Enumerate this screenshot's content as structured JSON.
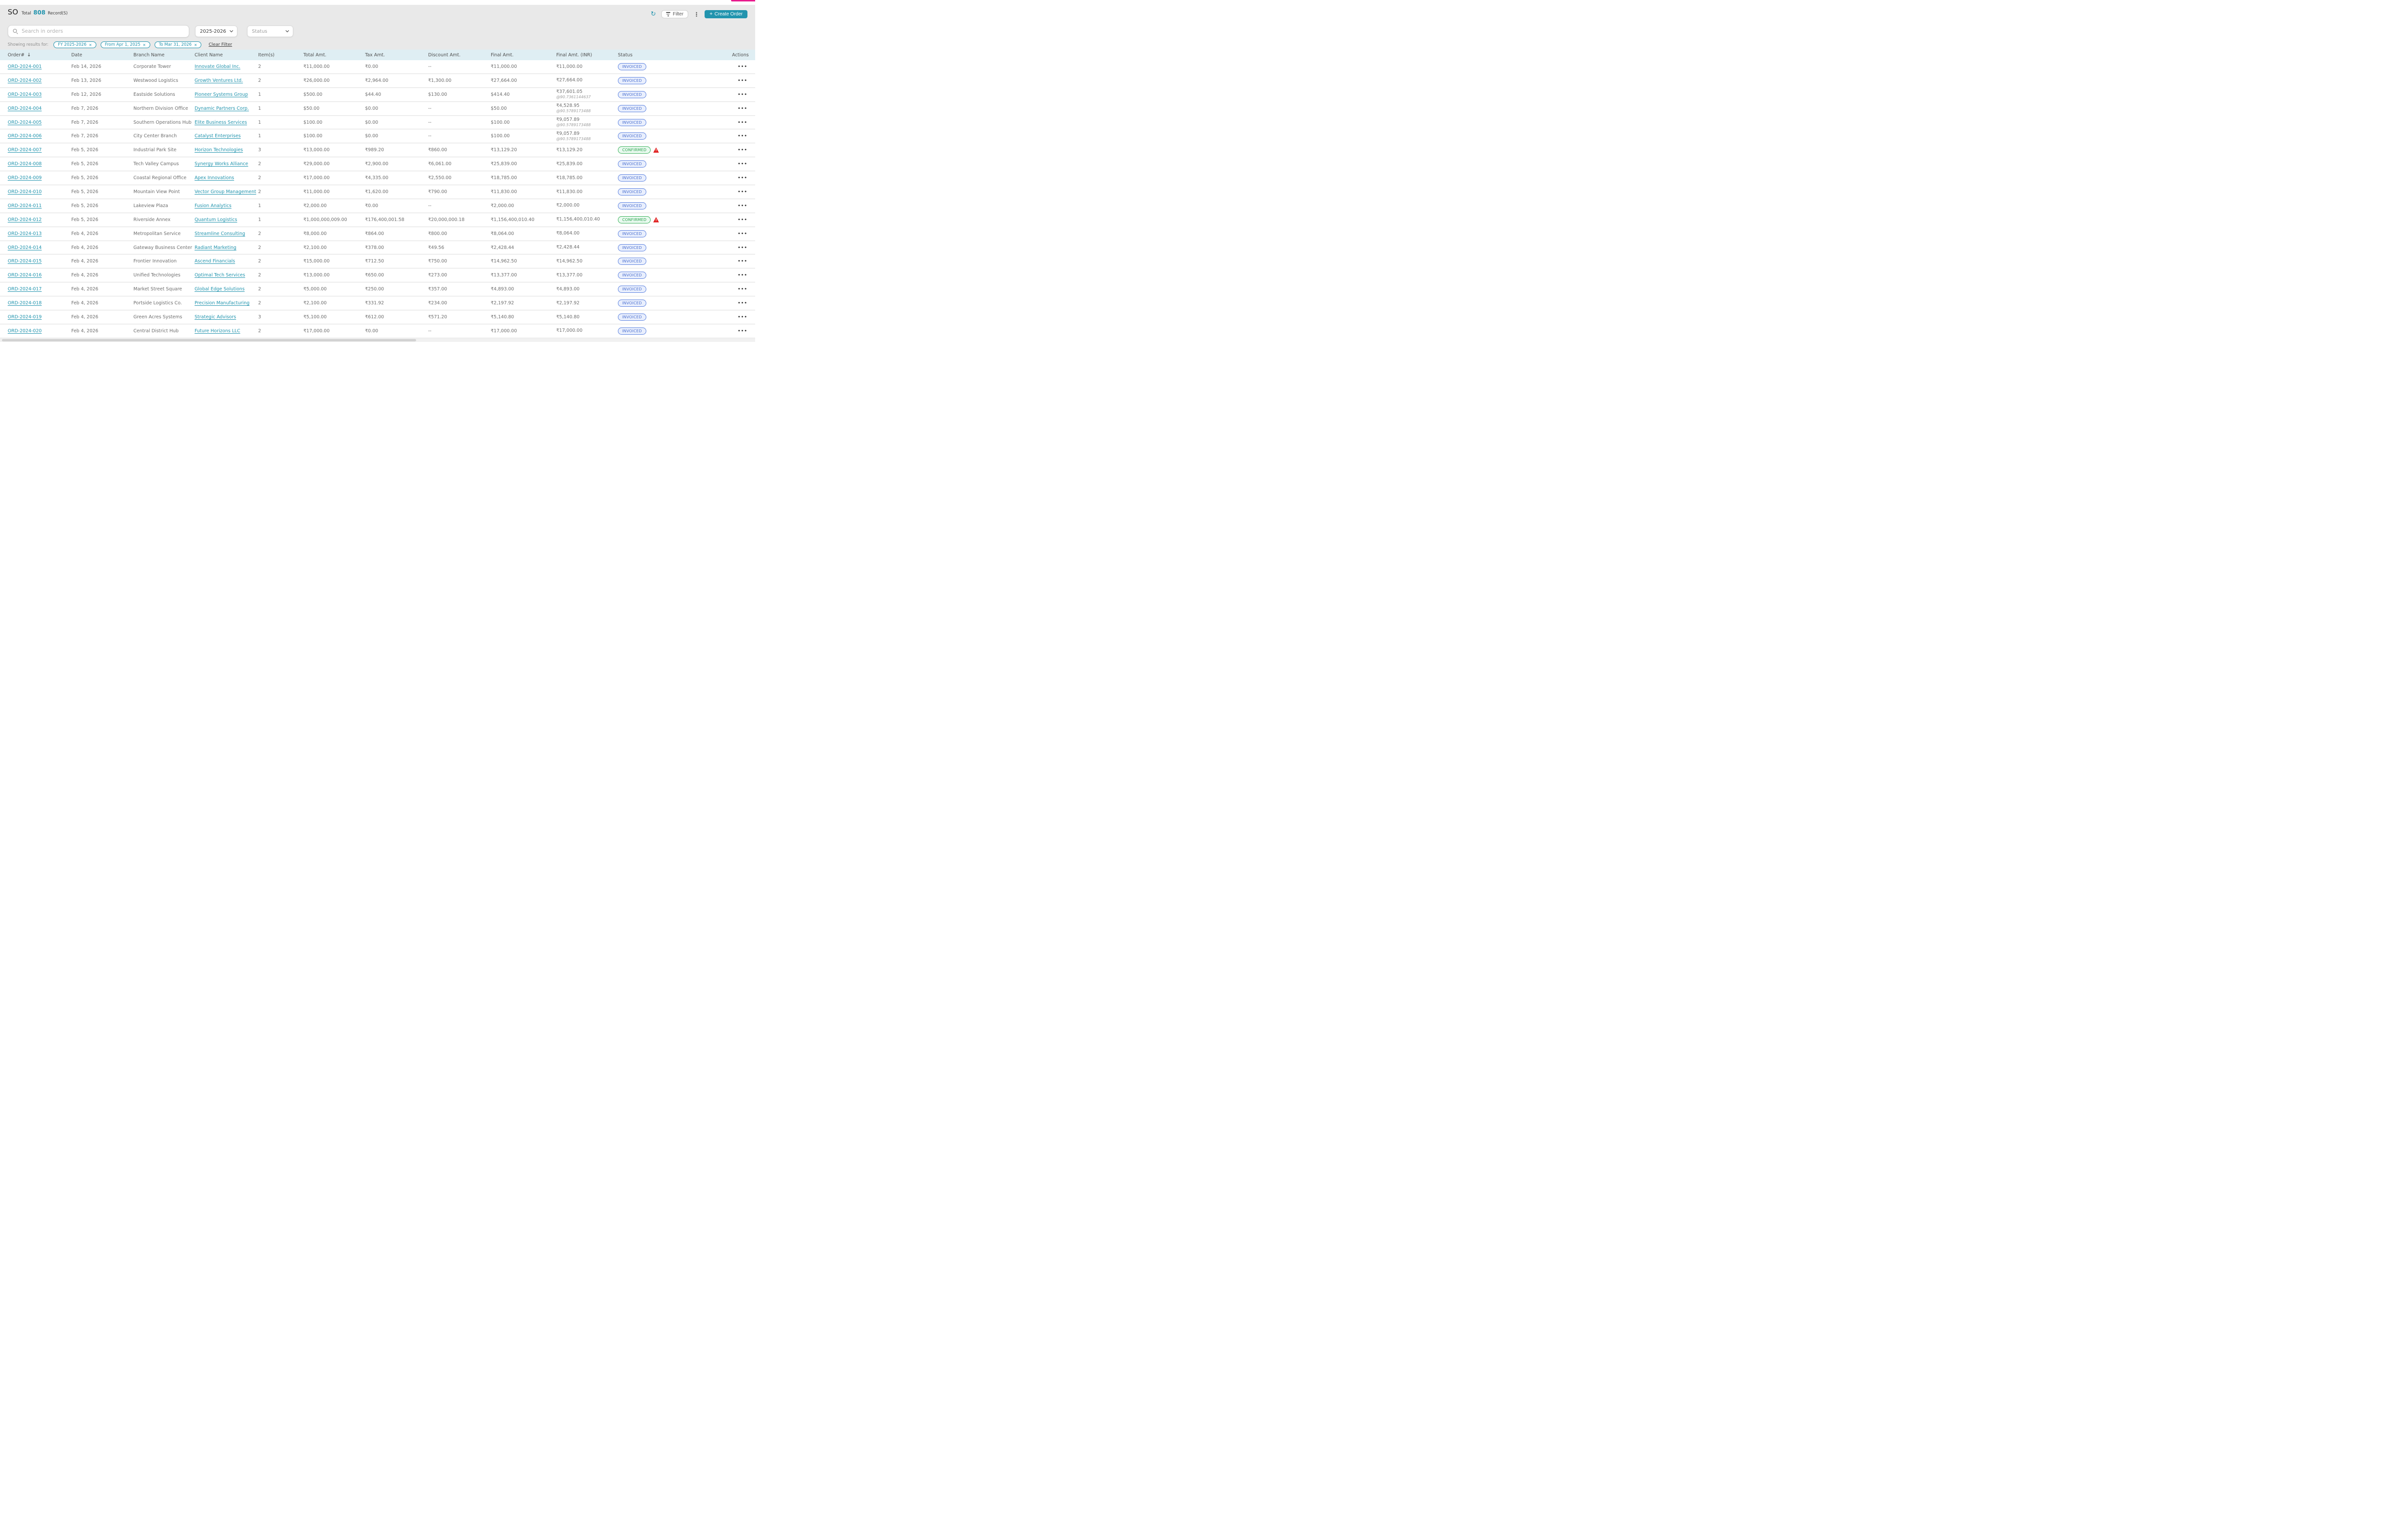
{
  "colors": {
    "accent_teal": "#2294ae",
    "brand_magenta": "#e81c8e",
    "invoiced_blue": "#4a6fd0",
    "confirmed_green": "#2ba24e",
    "warning_red": "#e01e1e",
    "table_header_bg": "#dfeef3",
    "toolbar_bg": "#e9e9e9"
  },
  "header": {
    "title": "SO",
    "total_label": "Total",
    "total_count": "808",
    "records_label": "Record(S)",
    "refresh_icon": "refresh",
    "filter_button_label": "Filter",
    "kebab_icon": "⋮",
    "create_order_plus": "+",
    "create_order_label": "Create Order"
  },
  "controls": {
    "search_placeholder": "Search in orders",
    "fiscal_year_value": "2025-2026",
    "status_placeholder": "Status"
  },
  "filters": {
    "showing_label": "Showing results for:",
    "chips": [
      {
        "label": "FY 2025-2026",
        "close": "✕"
      },
      {
        "label": "From Apr 1, 2025",
        "close": "✕"
      },
      {
        "label": "To Mar 31, 2026",
        "close": "✕"
      }
    ],
    "clear_label": "Clear Filter"
  },
  "table": {
    "columns": [
      "Order#",
      "Date",
      "Branch Name",
      "Client Name",
      "Item(s)",
      "Total Amt.",
      "Tax Amt.",
      "Discount Amt.",
      "Final Amt.",
      "Final Amt. (INR)",
      "Status",
      "Actions"
    ],
    "sort_arrow": "↓",
    "row_actions_icon": "●●●",
    "rows": [
      {
        "order_no": "ORD-2024-001",
        "date": "Feb 14, 2026",
        "branch": "Corporate Tower",
        "client": "Innovate Global Inc.",
        "items": "2",
        "total": "₹11,000.00",
        "tax": "₹0.00",
        "discount": "--",
        "final": "₹11,000.00",
        "inr": "₹11,000.00",
        "inr_rate": "",
        "status": "INVOICED",
        "warning": false
      },
      {
        "order_no": "ORD-2024-002",
        "date": "Feb 13, 2026",
        "branch": "Westwood Logistics",
        "client": "Growth Ventures Ltd.",
        "items": "2",
        "total": "₹26,000.00",
        "tax": "₹2,964.00",
        "discount": "₹1,300.00",
        "final": "₹27,664.00",
        "inr": "₹27,664.00",
        "inr_rate": "",
        "status": "INVOICED",
        "warning": false
      },
      {
        "order_no": "ORD-2024-003",
        "date": "Feb 12, 2026",
        "branch": "Eastside Solutions",
        "client": "Pioneer Systems Group",
        "items": "1",
        "total": "$500.00",
        "tax": "$44.40",
        "discount": "$130.00",
        "final": "$414.40",
        "inr": "₹37,601.05",
        "inr_rate": "@90.7361144637",
        "status": "INVOICED",
        "warning": false
      },
      {
        "order_no": "ORD-2024-004",
        "date": "Feb 7, 2026",
        "branch": "Northern Division Office",
        "client": "Dynamic Partners Corp.",
        "items": "1",
        "total": "$50.00",
        "tax": "$0.00",
        "discount": "--",
        "final": "$50.00",
        "inr": "₹4,528.95",
        "inr_rate": "@90.5789173488",
        "status": "INVOICED",
        "warning": false
      },
      {
        "order_no": "ORD-2024-005",
        "date": "Feb 7, 2026",
        "branch": "Southern Operations Hub",
        "client": "Elite Business Services",
        "items": "1",
        "total": "$100.00",
        "tax": "$0.00",
        "discount": "--",
        "final": "$100.00",
        "inr": "₹9,057.89",
        "inr_rate": "@90.5789173488",
        "status": "INVOICED",
        "warning": false
      },
      {
        "order_no": "ORD-2024-006",
        "date": "Feb 7, 2026",
        "branch": "City Center Branch",
        "client": "Catalyst Enterprises",
        "items": "1",
        "total": "$100.00",
        "tax": "$0.00",
        "discount": "--",
        "final": "$100.00",
        "inr": "₹9,057.89",
        "inr_rate": "@90.5789173488",
        "status": "INVOICED",
        "warning": false
      },
      {
        "order_no": "ORD-2024-007",
        "date": "Feb 5, 2026",
        "branch": "Industrial Park Site",
        "client": "Horizon Technologies",
        "items": "3",
        "total": "₹13,000.00",
        "tax": "₹989.20",
        "discount": "₹860.00",
        "final": "₹13,129.20",
        "inr": "₹13,129.20",
        "inr_rate": "",
        "status": "CONFIRMED",
        "warning": true
      },
      {
        "order_no": "ORD-2024-008",
        "date": "Feb 5, 2026",
        "branch": "Tech Valley Campus",
        "client": "Synergy Works Alliance",
        "items": "2",
        "total": "₹29,000.00",
        "tax": "₹2,900.00",
        "discount": "₹6,061.00",
        "final": "₹25,839.00",
        "inr": "₹25,839.00",
        "inr_rate": "",
        "status": "INVOICED",
        "warning": false
      },
      {
        "order_no": "ORD-2024-009",
        "date": "Feb 5, 2026",
        "branch": "Coastal Regional Office",
        "client": "Apex Innovations",
        "items": "2",
        "total": "₹17,000.00",
        "tax": "₹4,335.00",
        "discount": "₹2,550.00",
        "final": "₹18,785.00",
        "inr": "₹18,785.00",
        "inr_rate": "",
        "status": "INVOICED",
        "warning": false
      },
      {
        "order_no": "ORD-2024-010",
        "date": "Feb 5, 2026",
        "branch": "Mountain View Point",
        "client": "Vector Group Management",
        "items": "2",
        "total": "₹11,000.00",
        "tax": "₹1,620.00",
        "discount": "₹790.00",
        "final": "₹11,830.00",
        "inr": "₹11,830.00",
        "inr_rate": "",
        "status": "INVOICED",
        "warning": false
      },
      {
        "order_no": "ORD-2024-011",
        "date": "Feb 5, 2026",
        "branch": "Lakeview Plaza",
        "client": "Fusion Analytics",
        "items": "1",
        "total": "₹2,000.00",
        "tax": "₹0.00",
        "discount": "--",
        "final": "₹2,000.00",
        "inr": "₹2,000.00",
        "inr_rate": "",
        "status": "INVOICED",
        "warning": false
      },
      {
        "order_no": "ORD-2024-012",
        "date": "Feb 5, 2026",
        "branch": "Riverside Annex",
        "client": "Quantum Logistics",
        "items": "1",
        "total": "₹1,000,000,009.00",
        "tax": "₹176,400,001.58",
        "discount": "₹20,000,000.18",
        "final": "₹1,156,400,010.40",
        "inr": "₹1,156,400,010.40",
        "inr_rate": "",
        "status": "CONFIRMED",
        "warning": true
      },
      {
        "order_no": "ORD-2024-013",
        "date": "Feb 4, 2026",
        "branch": "Metropolitan Service",
        "client": "Streamline Consulting",
        "items": "2",
        "total": "₹8,000.00",
        "tax": "₹864.00",
        "discount": "₹800.00",
        "final": "₹8,064.00",
        "inr": "₹8,064.00",
        "inr_rate": "",
        "status": "INVOICED",
        "warning": false
      },
      {
        "order_no": "ORD-2024-014",
        "date": "Feb 4, 2026",
        "branch": "Gateway Business Center",
        "client": "Radiant Marketing",
        "items": "2",
        "total": "₹2,100.00",
        "tax": "₹378.00",
        "discount": "₹49.56",
        "final": "₹2,428.44",
        "inr": "₹2,428.44",
        "inr_rate": "",
        "status": "INVOICED",
        "warning": false
      },
      {
        "order_no": "ORD-2024-015",
        "date": "Feb 4, 2026",
        "branch": "Frontier Innovation",
        "client": "Ascend Financials",
        "items": "2",
        "total": "₹15,000.00",
        "tax": "₹712.50",
        "discount": "₹750.00",
        "final": "₹14,962.50",
        "inr": "₹14,962.50",
        "inr_rate": "",
        "status": "INVOICED",
        "warning": false
      },
      {
        "order_no": "ORD-2024-016",
        "date": "Feb 4, 2026",
        "branch": "Unified Technologies",
        "client": "Optimal Tech Services",
        "items": "2",
        "total": "₹13,000.00",
        "tax": "₹650.00",
        "discount": "₹273.00",
        "final": "₹13,377.00",
        "inr": "₹13,377.00",
        "inr_rate": "",
        "status": "INVOICED",
        "warning": false
      },
      {
        "order_no": "ORD-2024-017",
        "date": "Feb 4, 2026",
        "branch": "Market Street Square",
        "client": "Global Edge Solutions",
        "items": "2",
        "total": "₹5,000.00",
        "tax": "₹250.00",
        "discount": "₹357.00",
        "final": "₹4,893.00",
        "inr": "₹4,893.00",
        "inr_rate": "",
        "status": "INVOICED",
        "warning": false
      },
      {
        "order_no": "ORD-2024-018",
        "date": "Feb 4, 2026",
        "branch": "Portside Logistics Co.",
        "client": "Precision Manufacturing",
        "items": "2",
        "total": "₹2,100.00",
        "tax": "₹331.92",
        "discount": "₹234.00",
        "final": "₹2,197.92",
        "inr": "₹2,197.92",
        "inr_rate": "",
        "status": "INVOICED",
        "warning": false
      },
      {
        "order_no": "ORD-2024-019",
        "date": "Feb 4, 2026",
        "branch": "Green Acres Systems",
        "client": "Strategic Advisors",
        "items": "3",
        "total": "₹5,100.00",
        "tax": "₹612.00",
        "discount": "₹571.20",
        "final": "₹5,140.80",
        "inr": "₹5,140.80",
        "inr_rate": "",
        "status": "INVOICED",
        "warning": false
      },
      {
        "order_no": "ORD-2024-020",
        "date": "Feb 4, 2026",
        "branch": "Central District Hub",
        "client": "Future Horizons LLC",
        "items": "2",
        "total": "₹17,000.00",
        "tax": "₹0.00",
        "discount": "--",
        "final": "₹17,000.00",
        "inr": "₹17,000.00",
        "inr_rate": "",
        "status": "INVOICED",
        "warning": false
      }
    ]
  }
}
